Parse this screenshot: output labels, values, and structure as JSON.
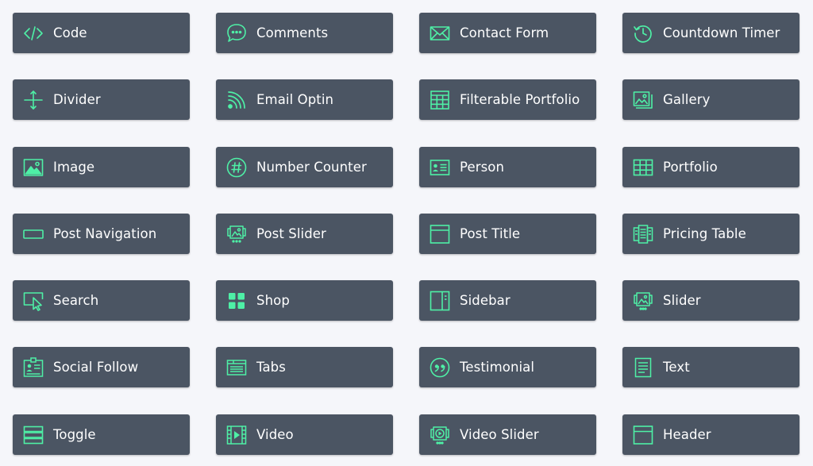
{
  "accent": "#4ef0a6",
  "tile_bg": "#4b5563",
  "modules": [
    {
      "label": "Code",
      "icon": "code-icon"
    },
    {
      "label": "Comments",
      "icon": "comments-icon"
    },
    {
      "label": "Contact Form",
      "icon": "envelope-icon"
    },
    {
      "label": "Countdown Timer",
      "icon": "clock-history-icon"
    },
    {
      "label": "Divider",
      "icon": "divider-icon"
    },
    {
      "label": "Email Optin",
      "icon": "rss-icon"
    },
    {
      "label": "Filterable Portfolio",
      "icon": "filter-grid-icon"
    },
    {
      "label": "Gallery",
      "icon": "gallery-icon"
    },
    {
      "label": "Image",
      "icon": "image-icon"
    },
    {
      "label": "Number Counter",
      "icon": "hash-icon"
    },
    {
      "label": "Person",
      "icon": "id-card-icon"
    },
    {
      "label": "Portfolio",
      "icon": "grid-icon"
    },
    {
      "label": "Post Navigation",
      "icon": "rectangle-icon"
    },
    {
      "label": "Post Slider",
      "icon": "post-slider-icon"
    },
    {
      "label": "Post Title",
      "icon": "window-icon"
    },
    {
      "label": "Pricing Table",
      "icon": "pricing-table-icon"
    },
    {
      "label": "Search",
      "icon": "cursor-box-icon"
    },
    {
      "label": "Shop",
      "icon": "shop-squares-icon"
    },
    {
      "label": "Sidebar",
      "icon": "sidebar-icon"
    },
    {
      "label": "Slider",
      "icon": "slider-icon"
    },
    {
      "label": "Social Follow",
      "icon": "badge-icon"
    },
    {
      "label": "Tabs",
      "icon": "tabs-icon"
    },
    {
      "label": "Testimonial",
      "icon": "quote-icon"
    },
    {
      "label": "Text",
      "icon": "document-icon"
    },
    {
      "label": "Toggle",
      "icon": "toggle-stack-icon"
    },
    {
      "label": "Video",
      "icon": "film-icon"
    },
    {
      "label": "Video Slider",
      "icon": "video-slider-icon"
    },
    {
      "label": "Header",
      "icon": "header-icon"
    }
  ]
}
